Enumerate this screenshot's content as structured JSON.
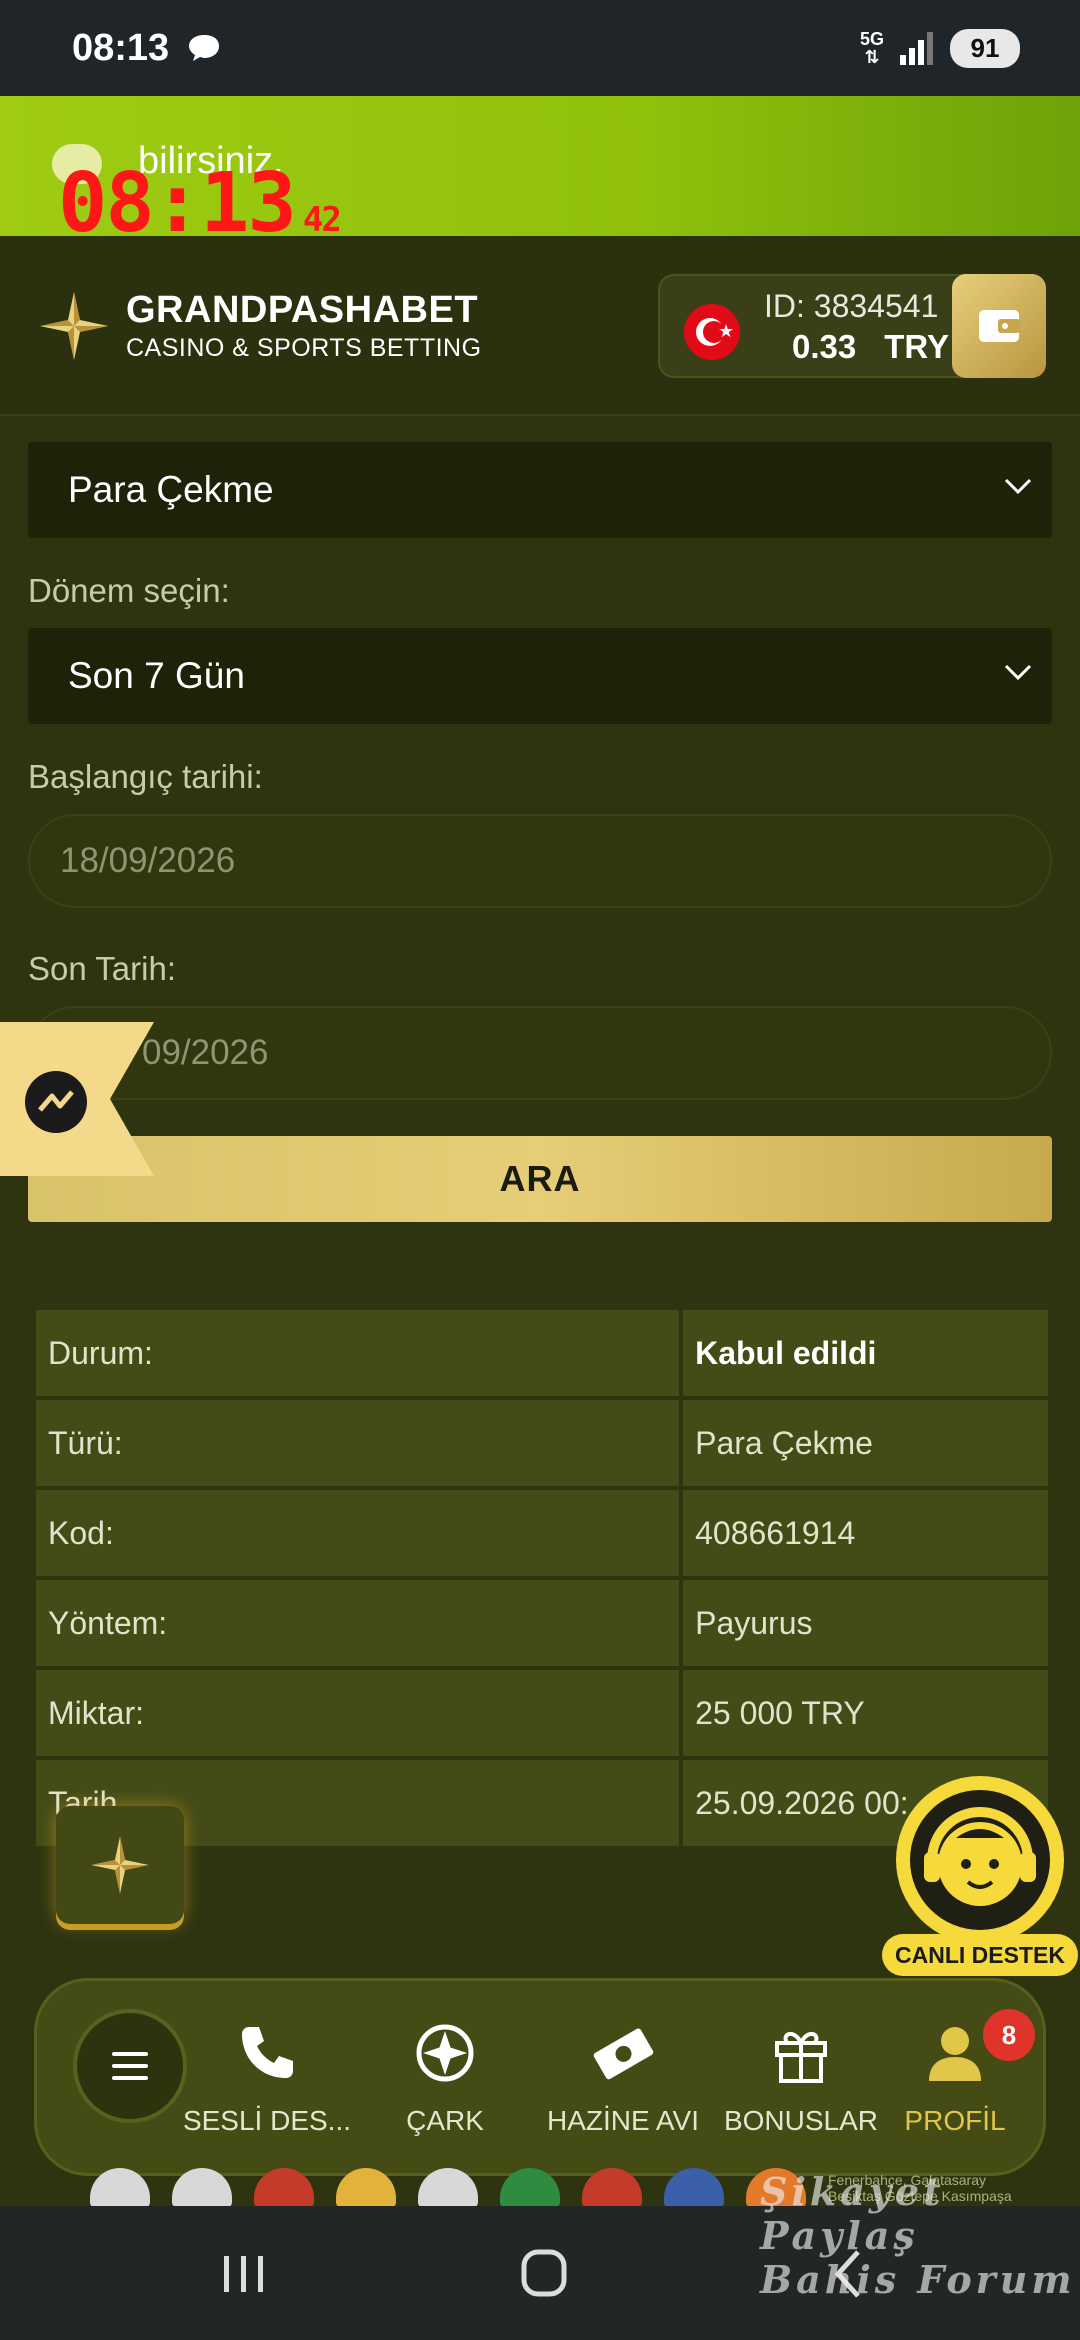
{
  "status_bar": {
    "time": "08:13",
    "network": "5G",
    "battery": "91"
  },
  "notification": {
    "text": "bilirsiniz.",
    "clock": "08:13",
    "clock_seconds": "42"
  },
  "header": {
    "brand_name": "GRANDPASHABET",
    "brand_sub": "CASINO & SPORTS BETTING",
    "account_id": "ID: 3834541",
    "balance": "0.33",
    "currency": "TRY"
  },
  "filters": {
    "type_value": "Para Çekme",
    "period_label": "Dönem seçin:",
    "period_value": "Son 7 Gün",
    "start_label": "Başlangıç tarihi:",
    "start_value": "18/09/2026",
    "end_label": "Son Tarih:",
    "end_value": "09/2026",
    "search_label": "ARA"
  },
  "details": [
    {
      "key": "Durum:",
      "value": "Kabul edildi"
    },
    {
      "key": "Türü:",
      "value": "Para Çekme"
    },
    {
      "key": "Kod:",
      "value": "408661914"
    },
    {
      "key": "Yöntem:",
      "value": "Payurus"
    },
    {
      "key": "Miktar:",
      "value": "25 000 TRY"
    },
    {
      "key": "Tarih",
      "value": "25.09.2026 00:"
    }
  ],
  "live_support": {
    "label": "CANLI DESTEK"
  },
  "bottom_nav": {
    "items": [
      {
        "label": "SESLİ DES..."
      },
      {
        "label": "ÇARK"
      },
      {
        "label": "HAZİNE AVI"
      },
      {
        "label": "BONUSLAR"
      },
      {
        "label": "PROFİL",
        "badge": "8"
      }
    ]
  },
  "sponsor_note": [
    "Fenerbahçe, Galatasaray",
    "Beşiktaş Göztepe Kasımpaşa"
  ],
  "watermark": [
    "Şikayet Paylaş",
    "Bahis Forum"
  ],
  "colors": {
    "accent_gold": "#e2c64a",
    "banner_green": "#9fcc13",
    "badge_red": "#e0332a"
  }
}
